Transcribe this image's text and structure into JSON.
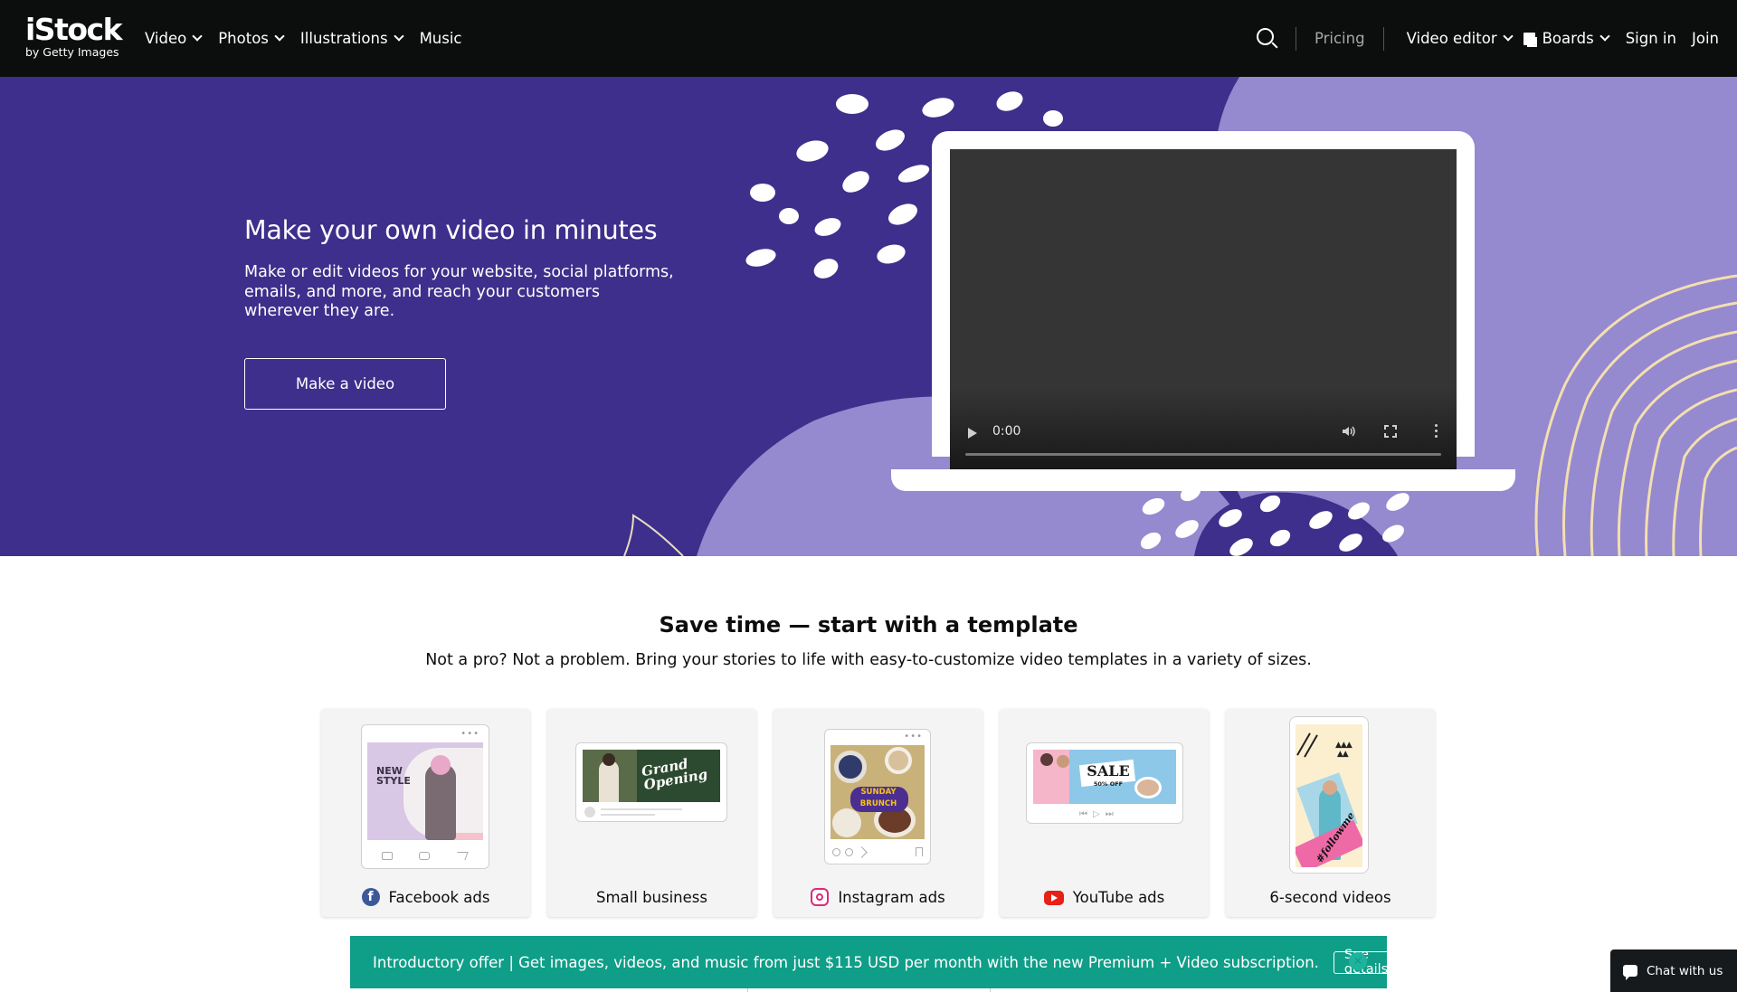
{
  "brand": {
    "name": "iStock",
    "sub": "by Getty Images"
  },
  "nav": {
    "left": [
      {
        "label": "Video",
        "has_menu": true
      },
      {
        "label": "Photos",
        "has_menu": true
      },
      {
        "label": "Illustrations",
        "has_menu": true
      },
      {
        "label": "Music",
        "has_menu": false
      }
    ],
    "pricing": "Pricing",
    "video_editor": "Video editor",
    "boards": "Boards",
    "sign_in": "Sign in",
    "join": "Join"
  },
  "hero": {
    "title": "Make your own video in minutes",
    "description": "Make or edit videos for your website, social platforms, emails, and more, and reach your customers wherever they are.",
    "button": "Make a video",
    "video_time": "0:00",
    "bg_color": "#3d2f8b",
    "accent_color": "#9589cf"
  },
  "templates": {
    "title": "Save time — start with a template",
    "subtitle": "Not a pro? Not a problem. Bring your stories to life with easy-to-customize video templates in a variety of sizes.",
    "cards": [
      {
        "label": "Facebook ads",
        "icon": "facebook-icon",
        "thumb_text": "NEW STYLE"
      },
      {
        "label": "Small business",
        "icon": "",
        "thumb_text": "Grand Opening"
      },
      {
        "label": "Instagram ads",
        "icon": "instagram-icon",
        "thumb_text": "SUNDAY BRUNCH"
      },
      {
        "label": "YouTube ads",
        "icon": "youtube-icon",
        "thumb_text": "SALE",
        "thumb_sub": "50% OFF"
      },
      {
        "label": "6-second videos",
        "icon": "",
        "thumb_text": "#followme"
      }
    ]
  },
  "promo": {
    "text": "Introductory offer | Get images, videos, and music from just $115 USD per month with the new Premium + Video subscription.",
    "button": "See details",
    "color": "#0f9e88"
  },
  "chat": {
    "label": "Chat with us"
  }
}
